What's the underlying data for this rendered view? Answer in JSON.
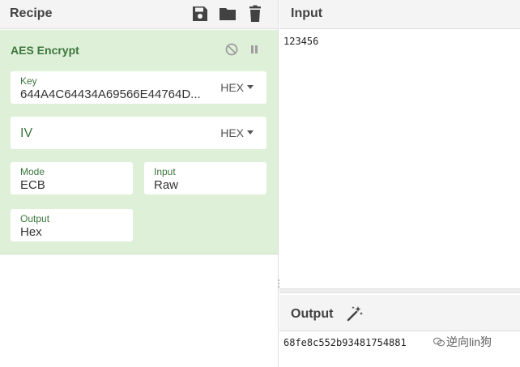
{
  "recipe": {
    "title": "Recipe",
    "header_icons": [
      "save-icon",
      "folder-icon",
      "trash-icon"
    ],
    "operation": {
      "title": "AES Encrypt",
      "controls": [
        "disable-icon",
        "pause-icon"
      ],
      "key": {
        "label": "Key",
        "value": "644A4C64434A69566E44764D...",
        "encoding": "HEX"
      },
      "iv": {
        "placeholder": "IV",
        "value": "",
        "encoding": "HEX"
      },
      "mode": {
        "label": "Mode",
        "value": "ECB"
      },
      "input": {
        "label": "Input",
        "value": "Raw"
      },
      "output": {
        "label": "Output",
        "value": "Hex"
      }
    }
  },
  "input": {
    "title": "Input",
    "text": "123456"
  },
  "output": {
    "title": "Output",
    "magic_icon": "magic-wand-icon",
    "text": "68fe8c552b93481754881",
    "watermark": "逆向lin狗"
  },
  "colors": {
    "recipe_bg": "#dff0d8",
    "green_text": "#3c763d",
    "header_bg": "#f4f4f4"
  }
}
